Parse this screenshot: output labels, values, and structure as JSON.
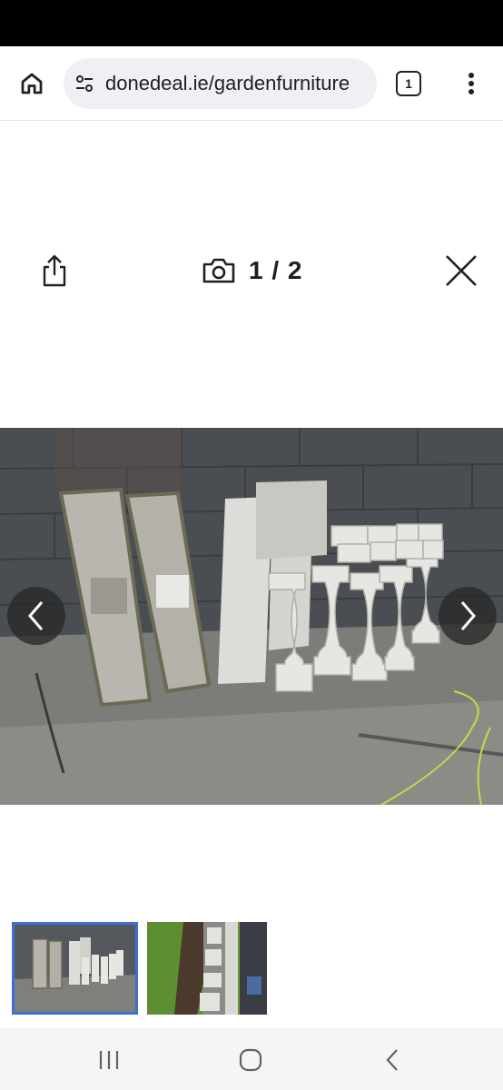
{
  "browser": {
    "url": "donedeal.ie/gardenfurniture",
    "tab_count": "1",
    "icons": {
      "home": "home-icon",
      "site_settings": "tune-icon",
      "menu": "more-vert-icon"
    }
  },
  "viewer": {
    "counter": "1 / 2",
    "icons": {
      "share": "share-icon",
      "camera": "camera-icon",
      "close": "close-icon",
      "prev": "chevron-left-icon",
      "next": "chevron-right-icon"
    }
  },
  "thumbnails": [
    {
      "name": "thumbnail-1",
      "selected": true
    },
    {
      "name": "thumbnail-2",
      "selected": false
    }
  ],
  "system_nav": {
    "icons": [
      "recents-icon",
      "home-icon",
      "back-icon"
    ]
  },
  "colors": {
    "selected_thumb_border": "#3b6fd6",
    "omnibox_bg": "#eef0f3"
  }
}
